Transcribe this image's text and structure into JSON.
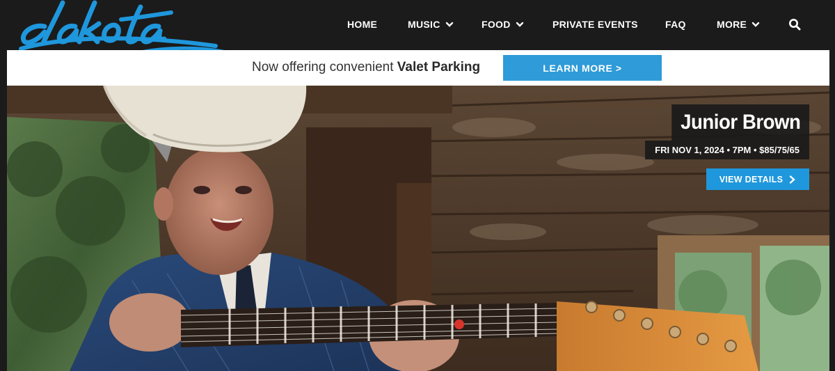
{
  "brand": {
    "logo_text": "dakota",
    "logo_color": "#1f97dc"
  },
  "nav": {
    "items": [
      {
        "label": "HOME",
        "has_dropdown": false
      },
      {
        "label": "MUSIC",
        "has_dropdown": true
      },
      {
        "label": "FOOD",
        "has_dropdown": true
      },
      {
        "label": "PRIVATE EVENTS",
        "has_dropdown": false
      },
      {
        "label": "FAQ",
        "has_dropdown": false
      },
      {
        "label": "MORE",
        "has_dropdown": true
      }
    ],
    "search_icon": "search-icon",
    "dropdown_icon": "chevron-down-icon"
  },
  "promo": {
    "text_lead": "Now offering convenient",
    "text_bold": "Valet Parking",
    "button_label": "LEARN MORE >",
    "button_color": "#2f9bd8"
  },
  "hero": {
    "artist": "Junior Brown",
    "meta": "FRI NOV 1, 2024 • 7PM • $85/75/65",
    "button_label": "VIEW DETAILS",
    "button_icon": "chevron-right-icon",
    "button_color": "#1f97dc"
  }
}
